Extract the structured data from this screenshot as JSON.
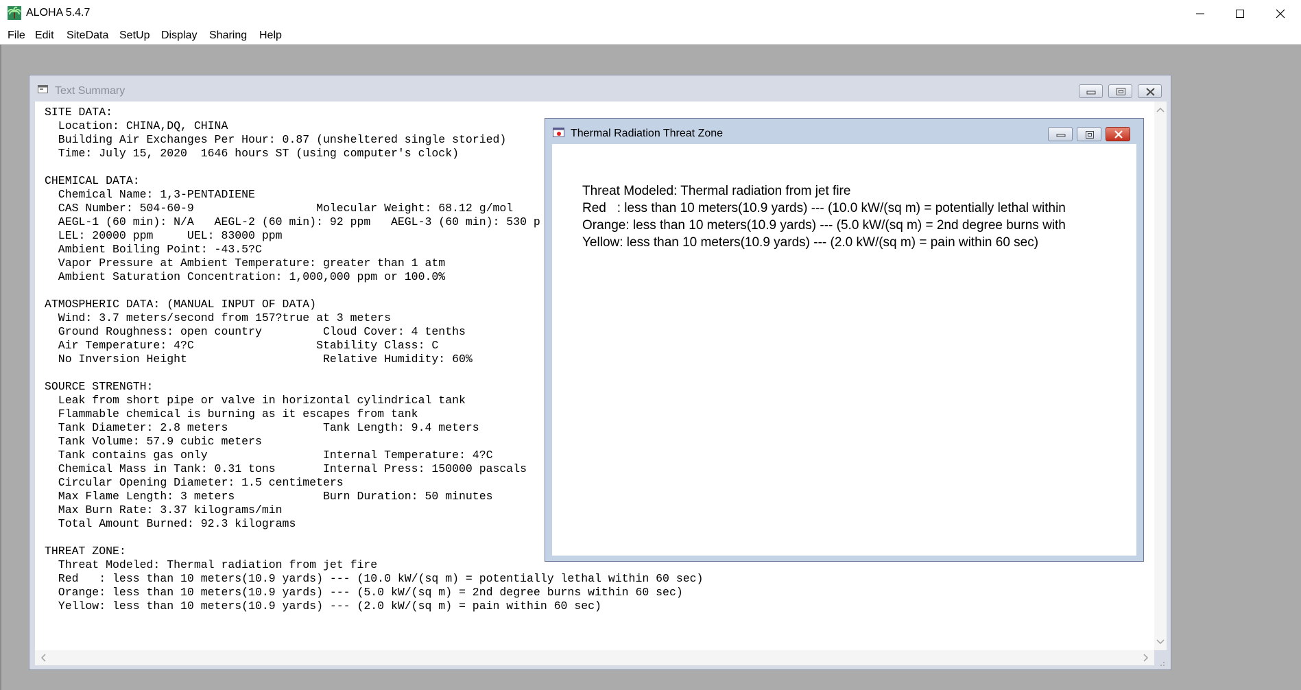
{
  "app": {
    "title": "ALOHA 5.4.7",
    "menu": [
      "File",
      "Edit",
      "SiteData",
      "SetUp",
      "Display",
      "Sharing",
      "Help"
    ]
  },
  "text_summary": {
    "title": "Text Summary",
    "lines": [
      "SITE DATA:",
      "  Location: CHINA,DQ, CHINA",
      "  Building Air Exchanges Per Hour: 0.87 (unsheltered single storied)",
      "  Time: July 15, 2020  1646 hours ST (using computer's clock)",
      "",
      "CHEMICAL DATA:",
      "  Chemical Name: 1,3-PENTADIENE",
      "  CAS Number: 504-60-9                  Molecular Weight: 68.12 g/mol",
      "  AEGL-1 (60 min): N/A   AEGL-2 (60 min): 92 ppm   AEGL-3 (60 min): 530 p",
      "  LEL: 20000 ppm     UEL: 83000 ppm",
      "  Ambient Boiling Point: -43.5?C",
      "  Vapor Pressure at Ambient Temperature: greater than 1 atm",
      "  Ambient Saturation Concentration: 1,000,000 ppm or 100.0%",
      "",
      "ATMOSPHERIC DATA: (MANUAL INPUT OF DATA)",
      "  Wind: 3.7 meters/second from 157?true at 3 meters",
      "  Ground Roughness: open country         Cloud Cover: 4 tenths",
      "  Air Temperature: 4?C                  Stability Class: C",
      "  No Inversion Height                    Relative Humidity: 60%",
      "",
      "SOURCE STRENGTH:",
      "  Leak from short pipe or valve in horizontal cylindrical tank",
      "  Flammable chemical is burning as it escapes from tank",
      "  Tank Diameter: 2.8 meters              Tank Length: 9.4 meters",
      "  Tank Volume: 57.9 cubic meters",
      "  Tank contains gas only                 Internal Temperature: 4?C",
      "  Chemical Mass in Tank: 0.31 tons       Internal Press: 150000 pascals",
      "  Circular Opening Diameter: 1.5 centimeters",
      "  Max Flame Length: 3 meters             Burn Duration: 50 minutes",
      "  Max Burn Rate: 3.37 kilograms/min",
      "  Total Amount Burned: 92.3 kilograms",
      "",
      "THREAT ZONE:",
      "  Threat Modeled: Thermal radiation from jet fire",
      "  Red   : less than 10 meters(10.9 yards) --- (10.0 kW/(sq m) = potentially lethal within 60 sec)",
      "  Orange: less than 10 meters(10.9 yards) --- (5.0 kW/(sq m) = 2nd degree burns within 60 sec)",
      "  Yellow: less than 10 meters(10.9 yards) --- (2.0 kW/(sq m) = pain within 60 sec)"
    ]
  },
  "threat_zone": {
    "title": "Thermal Radiation Threat Zone",
    "lines": [
      "Threat Modeled: Thermal radiation from jet fire",
      "Red   : less than 10 meters(10.9 yards) --- (10.0 kW/(sq m) = potentially lethal within",
      "Orange: less than 10 meters(10.9 yards) --- (5.0 kW/(sq m) = 2nd degree burns with",
      "Yellow: less than 10 meters(10.9 yards) --- (2.0 kW/(sq m) = pain within 60 sec)"
    ]
  }
}
